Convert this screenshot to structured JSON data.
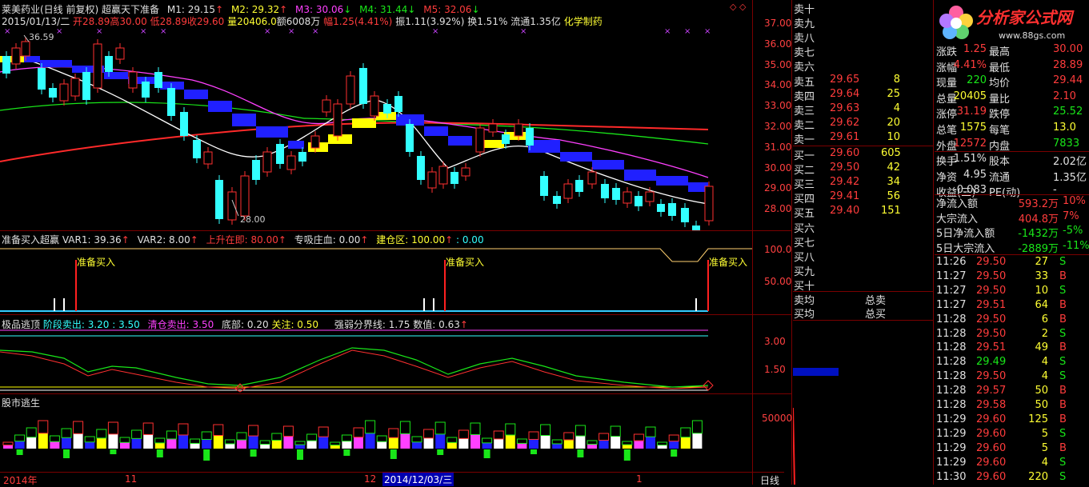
{
  "title": {
    "stock": "莱美药业(日线 前复权)",
    "formula": "超赢天下准备",
    "m1": "M1: 29.15",
    "m2": "M2: 29.32",
    "m3": "M3: 30.06",
    "m4": "M4: 31.44",
    "m5": "M5: 32.06",
    "arrow_up": "↑",
    "arrow_down": "↓"
  },
  "info_line": {
    "date": "2015/01/13/二",
    "open": "开28.89",
    "high": "高30.00",
    "low": "低28.89",
    "close": "收29.60",
    "volume": "量20406.0",
    "amount": "额6008万",
    "range": "幅1.25(4.41%)",
    "amplitude": "振1.11(3.92%)",
    "turnover": "换1.51%",
    "float": "流通1.35亿",
    "sector": "化学制药"
  },
  "price_labels": {
    "high": "36.59",
    "low": "28.00"
  },
  "y_axis_main": [
    "37.00",
    "36.00",
    "35.00",
    "34.00",
    "33.00",
    "32.00",
    "31.00",
    "30.00",
    "29.00",
    "28.00"
  ],
  "panel2": {
    "title": "准备买入超赢",
    "var1": "VAR1: 39.36",
    "var2": "VAR2: 8.00",
    "rising": "上升在即: 80.00",
    "absorb": "专吸庄血: 0.00",
    "build": "建仓区: 100.00",
    "tail": ": 0.00",
    "signal": "准备买入",
    "y_axis": [
      "100.0",
      "50.00"
    ]
  },
  "panel3": {
    "title": "极品逃顶",
    "stage_sell": "阶段卖出: 3.20 : 3.50",
    "clear_sell": "清仓卖出: 3.50",
    "bottom": "底部: 0.20",
    "focus": "关注: 0.50",
    "strength": "强弱分界线: 1.75",
    "value": "数值: 0.63",
    "y_axis": [
      "3.00",
      "1.50"
    ]
  },
  "panel4": {
    "title": "股市逃生",
    "y_axis": [
      "50000"
    ]
  },
  "x_axis": {
    "year": "2014年",
    "m11": "11",
    "m12": "12",
    "cursor_date": "2014/12/03/三",
    "m1": "1",
    "period": "日线"
  },
  "order_book": {
    "sell_labels": [
      "卖十",
      "卖九",
      "卖八",
      "卖七",
      "卖六",
      "卖五",
      "卖四",
      "卖三",
      "卖二",
      "卖一"
    ],
    "sell_prices": [
      "",
      "",
      "",
      "",
      "",
      "29.65",
      "29.64",
      "29.63",
      "29.62",
      "29.61"
    ],
    "sell_vols": [
      "",
      "",
      "",
      "",
      "",
      "8",
      "25",
      "4",
      "20",
      "10"
    ],
    "buy_labels": [
      "买一",
      "买二",
      "买三",
      "买四",
      "买五",
      "买六",
      "买七",
      "买八",
      "买九",
      "买十"
    ],
    "buy_prices": [
      "29.60",
      "29.50",
      "29.42",
      "29.41",
      "29.40",
      "",
      "",
      "",
      "",
      ""
    ],
    "buy_vols": [
      "605",
      "42",
      "34",
      "56",
      "151",
      "",
      "",
      "",
      "",
      ""
    ],
    "avg_sell": "卖均",
    "avg_buy": "买均",
    "total_sell": "总卖",
    "total_buy": "总买"
  },
  "quote": {
    "logo_name": "分析家公式网",
    "logo_url": "www.88gs.com",
    "rows": [
      {
        "l1": "涨跌",
        "v1": "1.25",
        "l2": "最高",
        "v2": "30.00"
      },
      {
        "l1": "涨幅",
        "v1": "4.41%",
        "l2": "最低",
        "v2": "28.89"
      },
      {
        "l1": "现量",
        "v1": "220",
        "l2": "均价",
        "v2": "29.44"
      },
      {
        "l1": "总量",
        "v1": "20405",
        "l2": "量比",
        "v2": "2.10"
      },
      {
        "l1": "涨停",
        "v1": "31.19",
        "l2": "跌停",
        "v2": "25.52"
      },
      {
        "l1": "总笔",
        "v1": "1575",
        "l2": "每笔",
        "v2": "13.0"
      },
      {
        "l1": "外盘",
        "v1": "12572",
        "l2": "内盘",
        "v2": "7833"
      },
      {
        "l1": "换手",
        "v1": "1.51%",
        "l2": "股本",
        "v2": "2.02亿"
      },
      {
        "l1": "净资",
        "v1": "4.95",
        "l2": "流通",
        "v2": "1.35亿"
      },
      {
        "l1": "收益(三)",
        "v1": "-0.083",
        "l2": "PE(动)",
        "v2": "-"
      }
    ],
    "flows": [
      {
        "l": "净流入额",
        "v": "593.2万",
        "p": "10%"
      },
      {
        "l": "大宗流入",
        "v": "404.8万",
        "p": "7%"
      },
      {
        "l": "5日净流入额",
        "v": "-1432万",
        "p": "-5%"
      },
      {
        "l": "5日大宗流入",
        "v": "-2889万",
        "p": "-11%"
      }
    ]
  },
  "ticks": [
    {
      "t": "11:26",
      "p": "29.50",
      "v": "27",
      "s": "S"
    },
    {
      "t": "11:27",
      "p": "29.50",
      "v": "33",
      "s": "B"
    },
    {
      "t": "11:27",
      "p": "29.50",
      "v": "10",
      "s": "S"
    },
    {
      "t": "11:27",
      "p": "29.51",
      "v": "64",
      "s": "B"
    },
    {
      "t": "11:28",
      "p": "29.50",
      "v": "6",
      "s": "B"
    },
    {
      "t": "11:28",
      "p": "29.50",
      "v": "2",
      "s": "S"
    },
    {
      "t": "11:28",
      "p": "29.51",
      "v": "49",
      "s": "B"
    },
    {
      "t": "11:28",
      "p": "29.49",
      "v": "4",
      "s": "S"
    },
    {
      "t": "11:28",
      "p": "29.50",
      "v": "4",
      "s": "S"
    },
    {
      "t": "11:28",
      "p": "29.57",
      "v": "50",
      "s": "B"
    },
    {
      "t": "11:28",
      "p": "29.58",
      "v": "50",
      "s": "B"
    },
    {
      "t": "11:29",
      "p": "29.60",
      "v": "125",
      "s": "B"
    },
    {
      "t": "11:29",
      "p": "29.60",
      "v": "5",
      "s": "S"
    },
    {
      "t": "11:29",
      "p": "29.60",
      "v": "5",
      "s": "B"
    },
    {
      "t": "11:29",
      "p": "29.60",
      "v": "4",
      "s": "S"
    },
    {
      "t": "11:30",
      "p": "29.60",
      "v": "220",
      "s": "S"
    }
  ],
  "colors": {
    "up": "#ff3c3c",
    "down": "#33ffff",
    "grid": "#7a0000",
    "accent": "#ffff33"
  }
}
